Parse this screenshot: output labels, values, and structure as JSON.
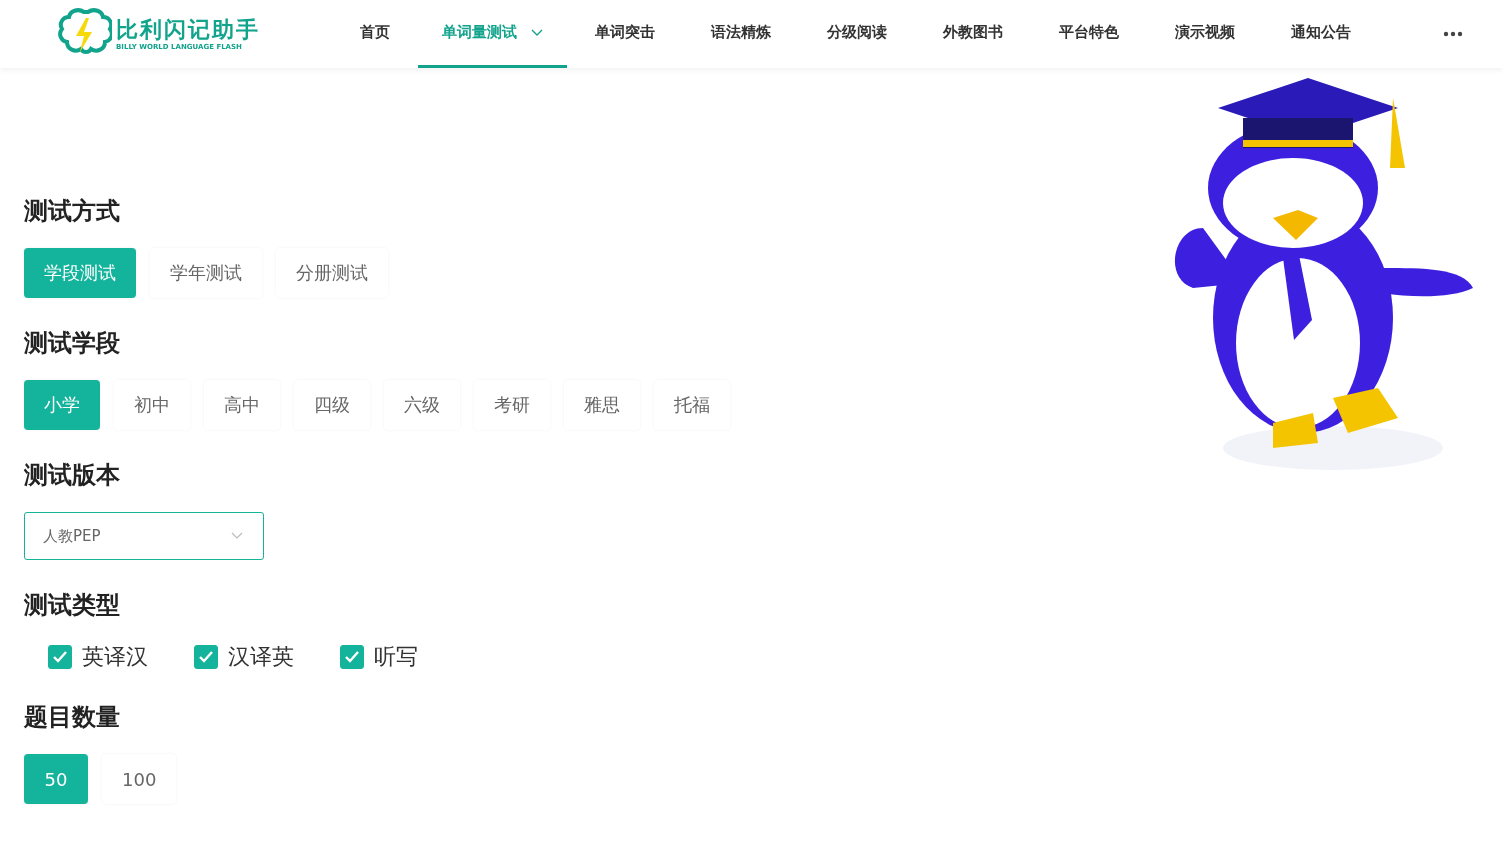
{
  "logo": {
    "title": "比利闪记助手",
    "subtitle": "BILLY WORLD LANGUAGE FLASH"
  },
  "nav": [
    {
      "label": "首页",
      "selected": false,
      "dropdown": false
    },
    {
      "label": "单词量测试",
      "selected": true,
      "dropdown": true
    },
    {
      "label": "单词突击",
      "selected": false,
      "dropdown": false
    },
    {
      "label": "语法精炼",
      "selected": false,
      "dropdown": false
    },
    {
      "label": "分级阅读",
      "selected": false,
      "dropdown": false
    },
    {
      "label": "外教图书",
      "selected": false,
      "dropdown": false
    },
    {
      "label": "平台特色",
      "selected": false,
      "dropdown": false
    },
    {
      "label": "演示视频",
      "selected": false,
      "dropdown": false
    },
    {
      "label": "通知公告",
      "selected": false,
      "dropdown": false
    }
  ],
  "sections": [
    {
      "title": "测试方式",
      "kind": "options",
      "options": [
        {
          "label": "学段测试",
          "selected": true
        },
        {
          "label": "学年测试",
          "selected": false
        },
        {
          "label": "分册测试",
          "selected": false
        }
      ]
    },
    {
      "title": "测试学段",
      "kind": "options",
      "options": [
        {
          "label": "小学",
          "selected": true
        },
        {
          "label": "初中",
          "selected": false
        },
        {
          "label": "高中",
          "selected": false
        },
        {
          "label": "四级",
          "selected": false
        },
        {
          "label": "六级",
          "selected": false
        },
        {
          "label": "考研",
          "selected": false
        },
        {
          "label": "雅思",
          "selected": false
        },
        {
          "label": "托福",
          "selected": false
        }
      ]
    },
    {
      "title": "测试版本",
      "kind": "select",
      "value": "人教PEP"
    },
    {
      "title": "测试类型",
      "kind": "checks",
      "checks": [
        {
          "label": "英译汉",
          "checked": true
        },
        {
          "label": "汉译英",
          "checked": true
        },
        {
          "label": "听写",
          "checked": true
        }
      ]
    },
    {
      "title": "题目数量",
      "kind": "options",
      "options": [
        {
          "label": "50",
          "selected": true
        },
        {
          "label": "100",
          "selected": false
        }
      ]
    }
  ]
}
